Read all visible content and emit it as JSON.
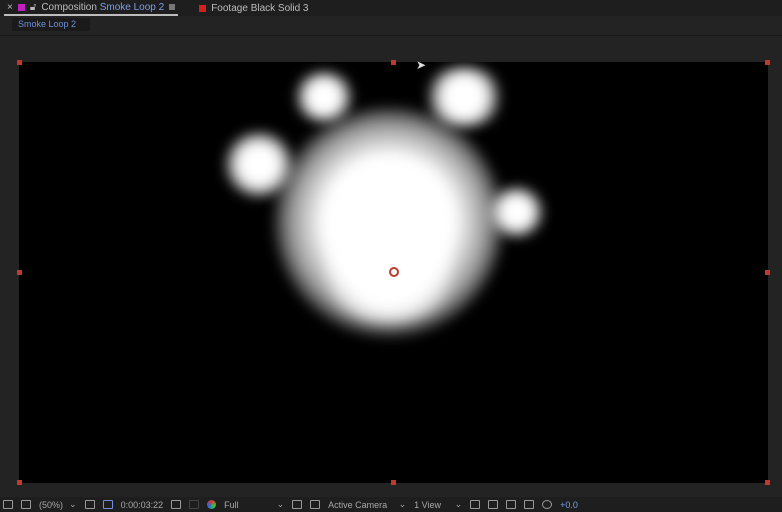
{
  "tabs": [
    {
      "prefix": "Composition",
      "name": "Smoke Loop 2",
      "color": "#c020c0",
      "close": "×"
    },
    {
      "prefix": "Footage",
      "name": "Black Solid 3",
      "color": "#d02020"
    }
  ],
  "subtab": "Smoke Loop 2",
  "toolbar": {
    "zoom": "(50%)",
    "timecode": "0:00:03:22",
    "resolution": "Full",
    "camera": "Active Camera",
    "views": "1 View",
    "exposure": "+0.0",
    "chevron": "⌄"
  }
}
